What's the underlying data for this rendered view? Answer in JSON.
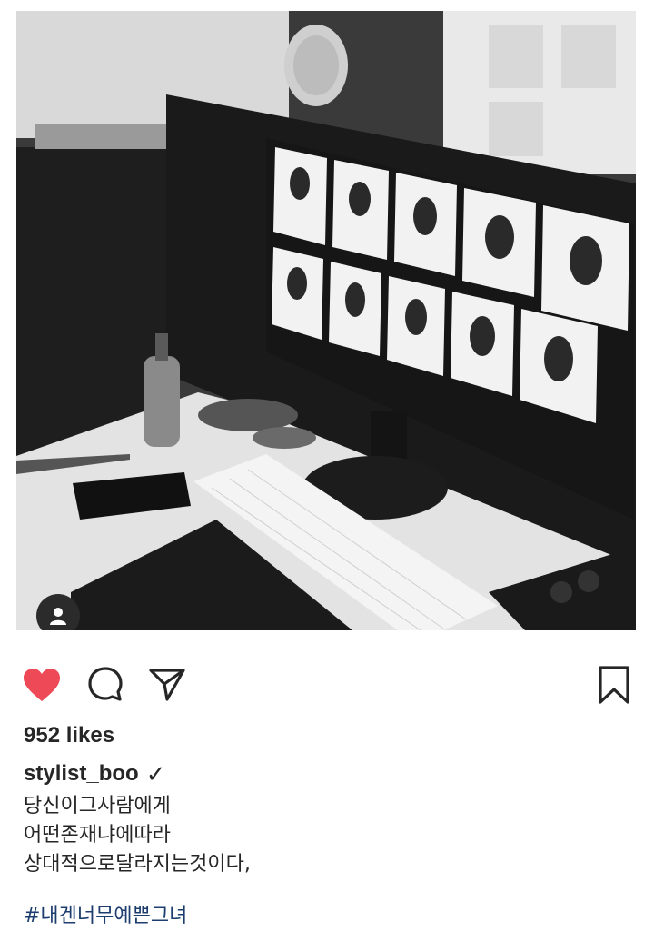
{
  "post": {
    "likes_text": "952 likes",
    "username": "stylist_boo",
    "verified_mark": "✓",
    "caption_lines": [
      "당신이그사람에게",
      "어떤존재냐에따라",
      "상대적으로달라지는것이다,"
    ],
    "hashtag": "#내겐너무예쁜그녀"
  },
  "actions": {
    "like_icon": "heart-filled-icon",
    "comment_icon": "comment-icon",
    "share_icon": "paper-plane-icon",
    "save_icon": "bookmark-icon",
    "like_color": "#ed4956"
  },
  "photo": {
    "description_icon": "user-tag-icon"
  }
}
